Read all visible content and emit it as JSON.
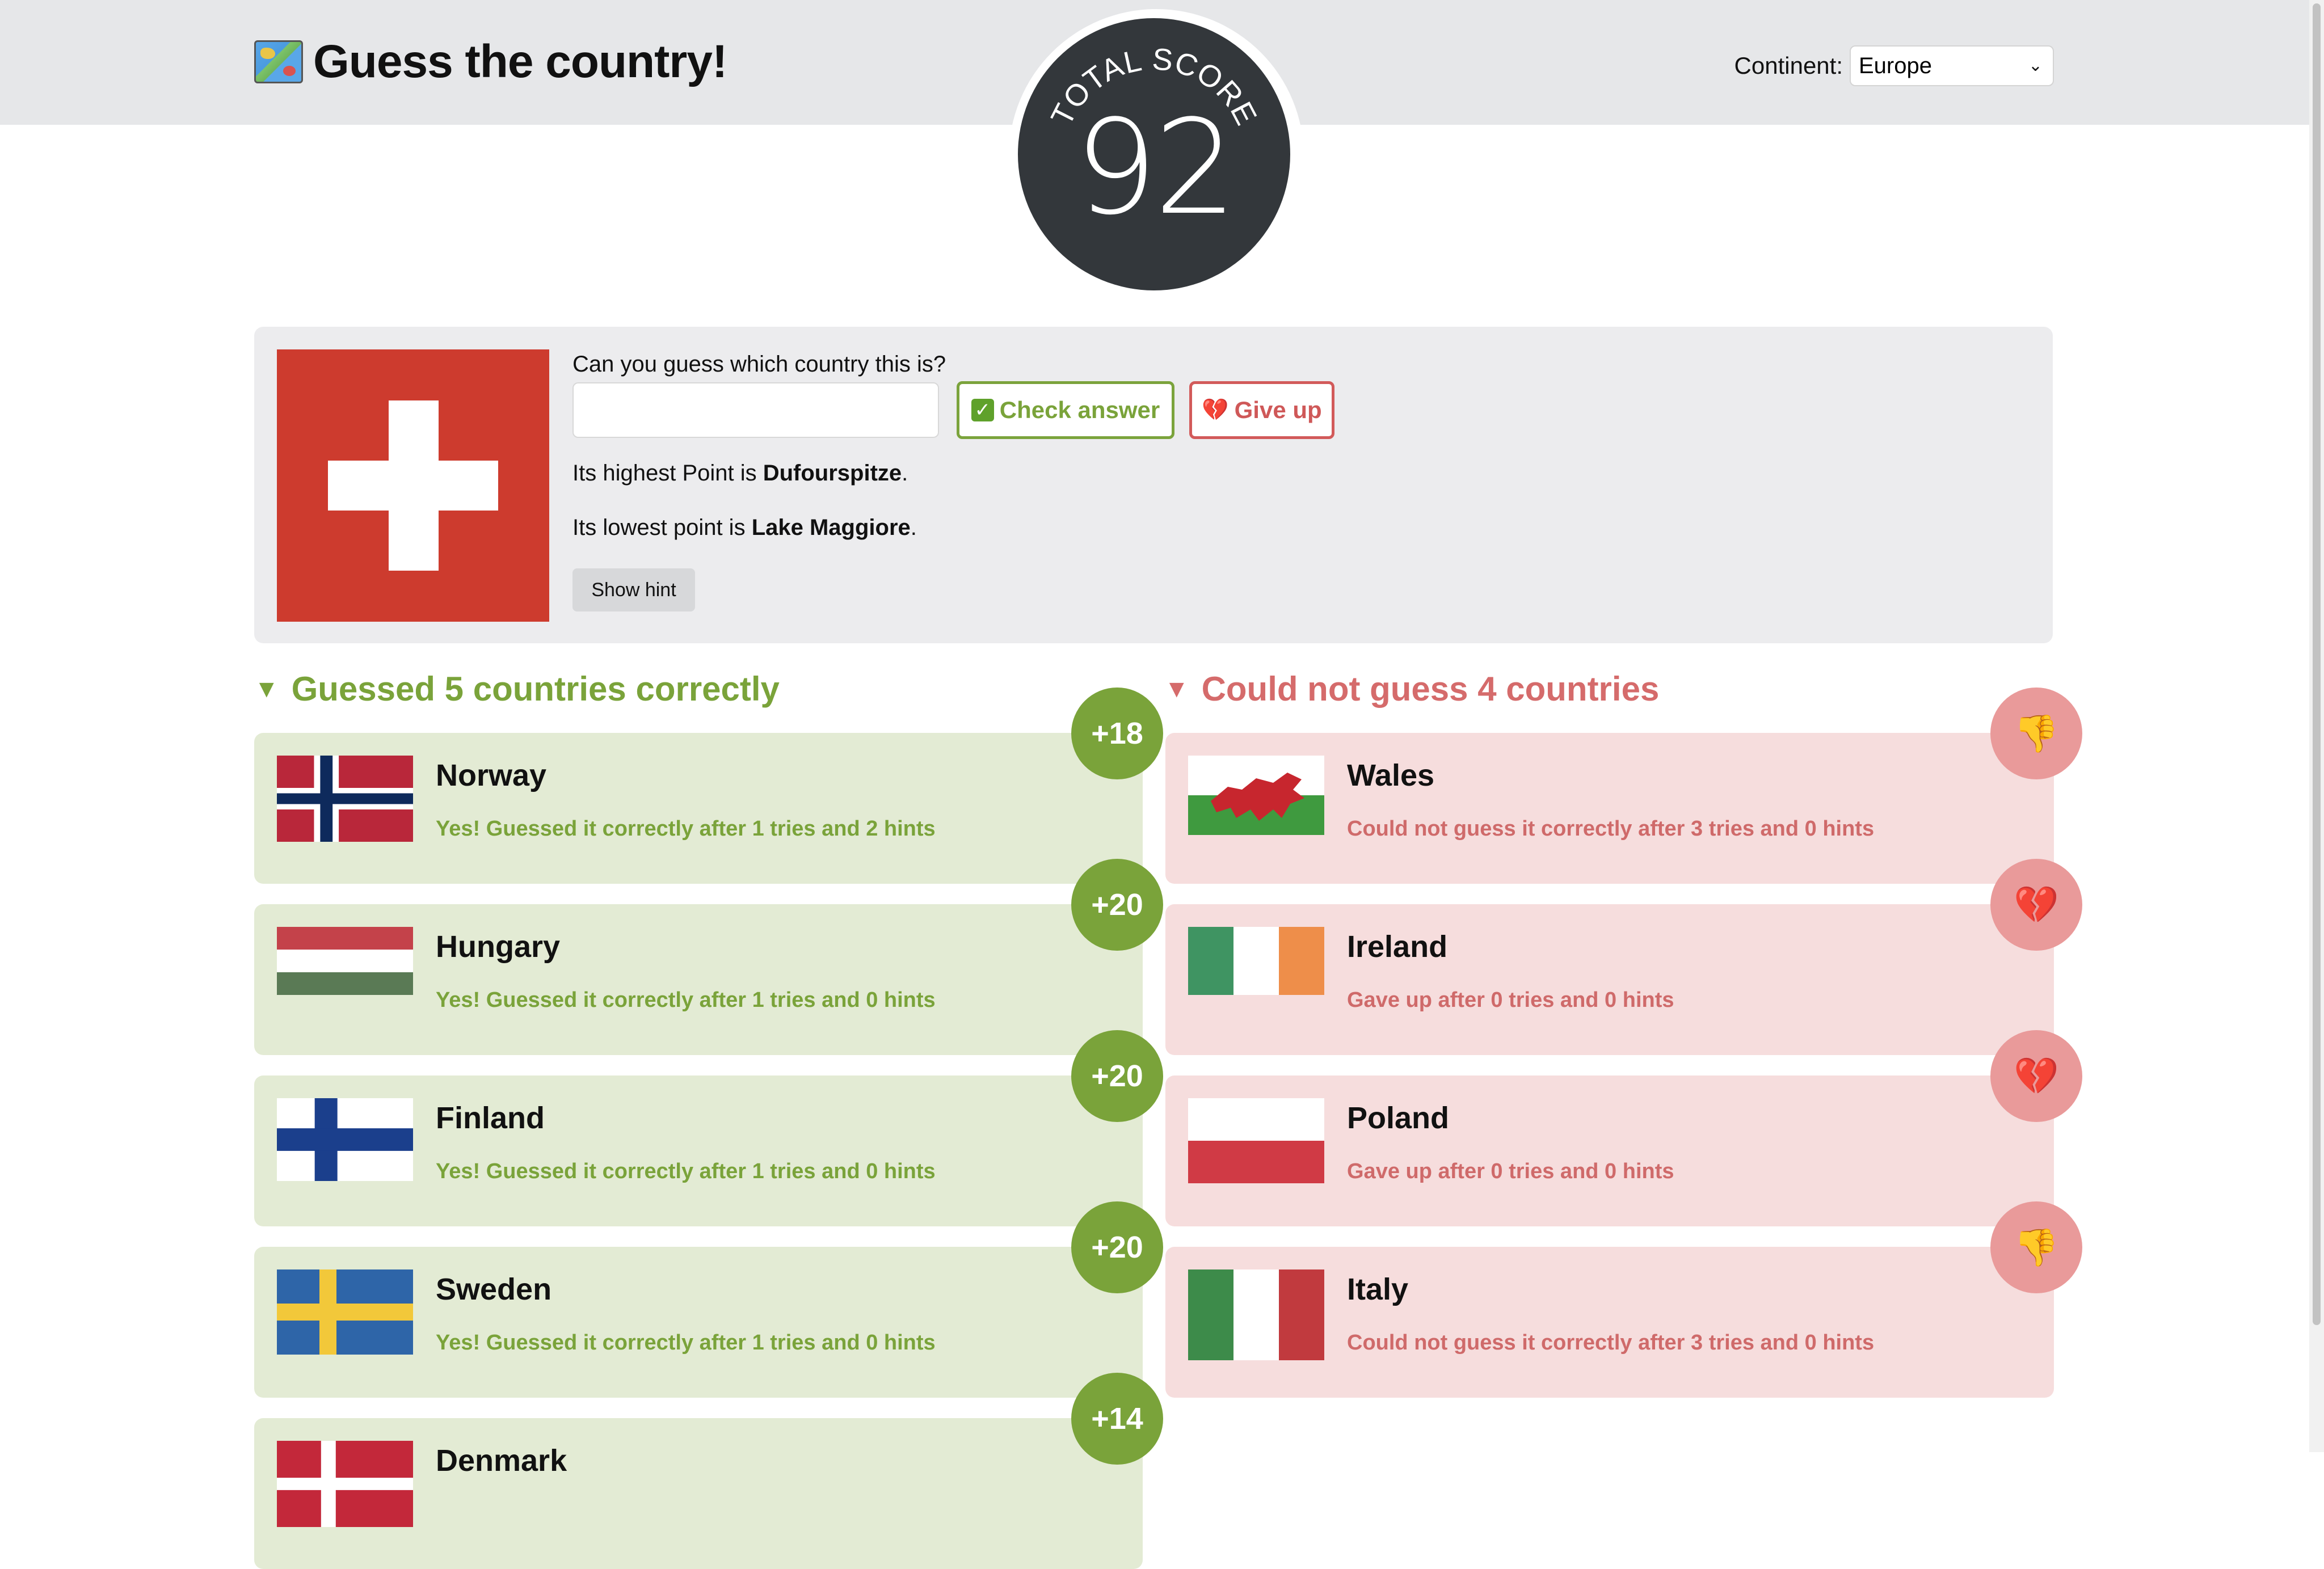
{
  "header": {
    "title": "Guess the country!",
    "title_icon": "world-map-icon",
    "continent_label": "Continent:",
    "continent_value": "Europe"
  },
  "score": {
    "label": "TOTAL SCORE",
    "value": "92"
  },
  "quiz": {
    "flag": "Switzerland-flag",
    "question": "Can you guess which country this is?",
    "input_value": "",
    "check_button": "Check answer",
    "check_icon": "check-box-icon",
    "give_up_button": "Give up",
    "give_up_icon": "broken-heart-icon",
    "hint1_prefix": "Its highest Point is ",
    "hint1_value": "Dufourspitze",
    "hint1_suffix": ".",
    "hint2_prefix": "Its lowest point is ",
    "hint2_value": "Lake Maggiore",
    "hint2_suffix": ".",
    "show_hint_button": "Show hint"
  },
  "correct": {
    "title": "Guessed 5 countries correctly",
    "items": [
      {
        "name": "Norway",
        "result": "Yes! Guessed it correctly after 1 tries and 2 hints",
        "points": "+18",
        "flag": "norway"
      },
      {
        "name": "Hungary",
        "result": "Yes! Guessed it correctly after 1 tries and 0 hints",
        "points": "+20",
        "flag": "hungary"
      },
      {
        "name": "Finland",
        "result": "Yes! Guessed it correctly after 1 tries and 0 hints",
        "points": "+20",
        "flag": "finland"
      },
      {
        "name": "Sweden",
        "result": "Yes! Guessed it correctly after 1 tries and 0 hints",
        "points": "+20",
        "flag": "sweden"
      },
      {
        "name": "Denmark",
        "result": "",
        "points": "+14",
        "flag": "denmark"
      }
    ]
  },
  "failed": {
    "title": "Could not guess 4 countries",
    "items": [
      {
        "name": "Wales",
        "result": "Could not guess it correctly after 3 tries and 0 hints",
        "icon": "thumbs-down-icon",
        "flag": "wales"
      },
      {
        "name": "Ireland",
        "result": "Gave up after 0 tries and 0 hints",
        "icon": "broken-heart-icon",
        "flag": "ireland"
      },
      {
        "name": "Poland",
        "result": "Gave up after 0 tries and 0 hints",
        "icon": "broken-heart-icon",
        "flag": "poland"
      },
      {
        "name": "Italy",
        "result": "Could not guess it correctly after 3 tries and 0 hints",
        "icon": "thumbs-down-icon",
        "flag": "italy"
      }
    ]
  },
  "colors": {
    "success": "#7aa33a",
    "failure": "#d56b6b",
    "score_circle": "#33373b"
  }
}
